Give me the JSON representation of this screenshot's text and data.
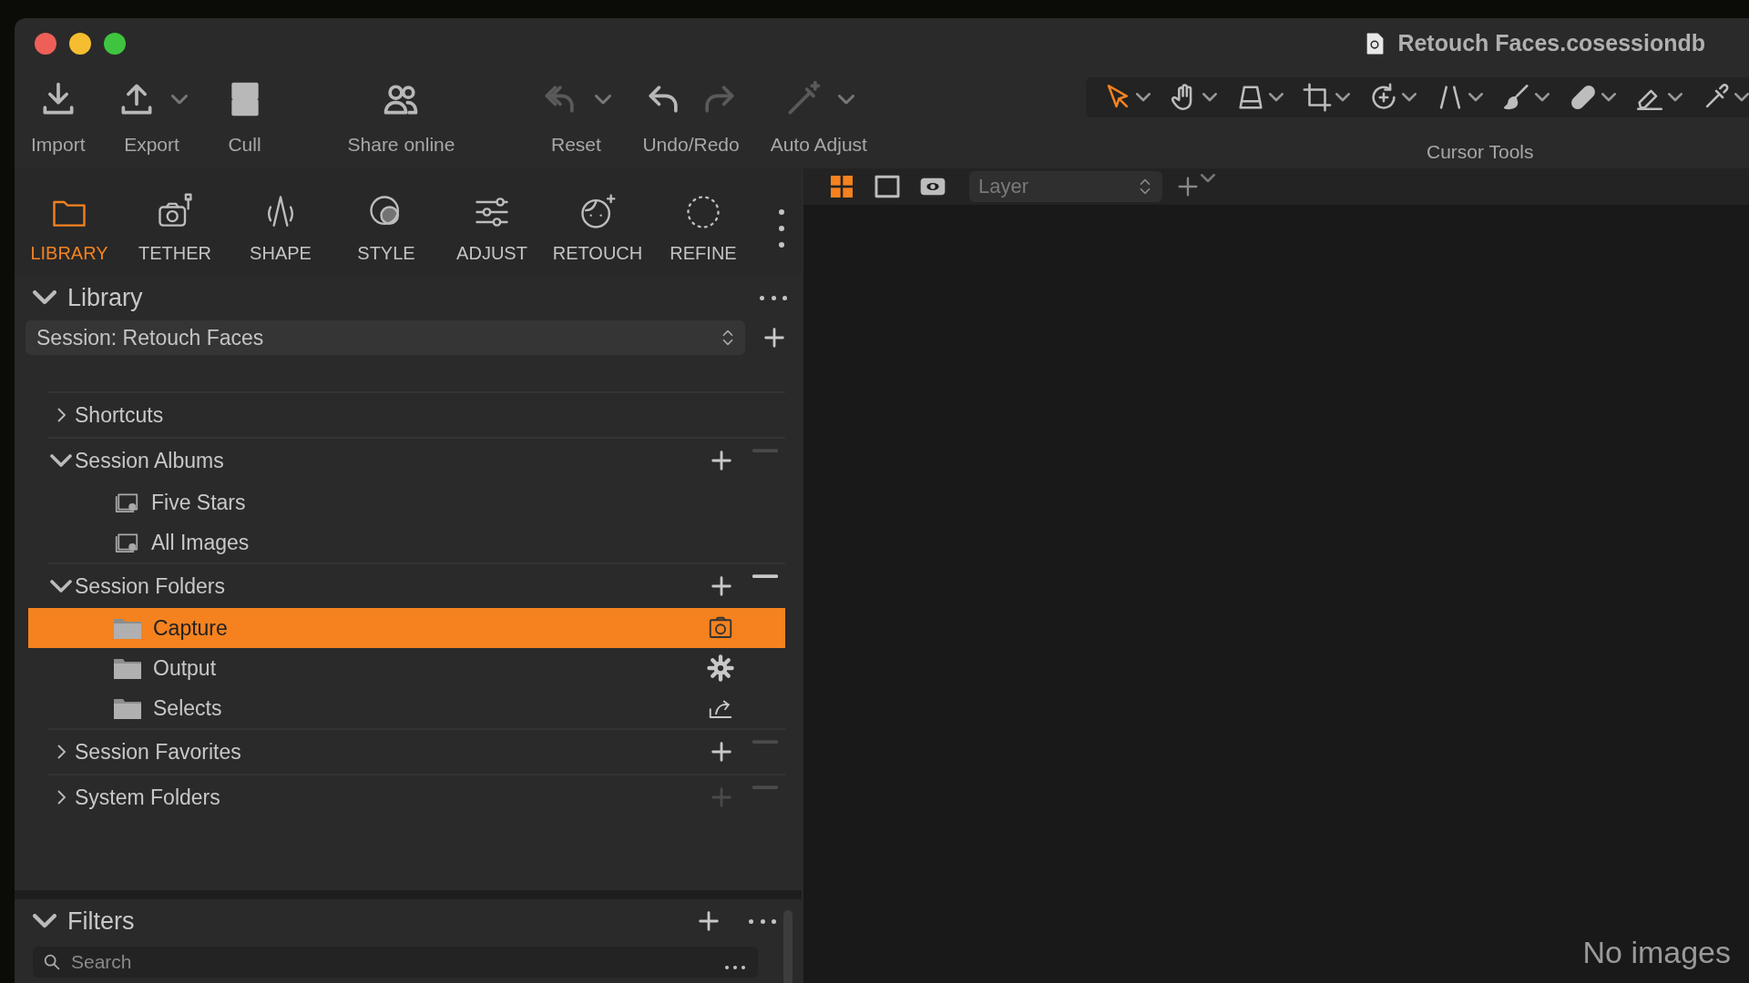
{
  "window": {
    "title": "Retouch Faces.cosessiondb"
  },
  "toolbar": {
    "items": [
      {
        "label": "Import",
        "icons": [
          {
            "kind": "import",
            "disabled": false
          }
        ],
        "menu": false
      },
      {
        "label": "Export",
        "icons": [
          {
            "kind": "export",
            "disabled": false
          }
        ],
        "menu": true
      },
      {
        "label": "Cull",
        "icons": [
          {
            "kind": "cull",
            "disabled": false
          }
        ],
        "menu": false
      },
      {
        "label": "Share online",
        "icons": [
          {
            "kind": "share",
            "disabled": false
          }
        ],
        "menu": false
      },
      {
        "label": "Reset",
        "icons": [
          {
            "kind": "reset",
            "disabled": true
          }
        ],
        "menu": true
      },
      {
        "label": "Undo/Redo",
        "icons": [
          {
            "kind": "undo",
            "disabled": false
          },
          {
            "kind": "redo",
            "disabled": true
          }
        ],
        "menu": false
      },
      {
        "label": "Auto Adjust",
        "icons": [
          {
            "kind": "wand",
            "disabled": true
          }
        ],
        "menu": true
      }
    ]
  },
  "cursor_tools": {
    "label": "Cursor Tools",
    "tools": [
      {
        "kind": "pointer",
        "selected": true
      },
      {
        "kind": "hand",
        "selected": false
      },
      {
        "kind": "keystone",
        "selected": false
      },
      {
        "kind": "crop",
        "selected": false
      },
      {
        "kind": "rotate",
        "selected": false
      },
      {
        "kind": "lines",
        "selected": false
      },
      {
        "kind": "brush",
        "selected": false
      },
      {
        "kind": "bandage",
        "selected": false
      },
      {
        "kind": "eraser",
        "selected": false
      },
      {
        "kind": "picker",
        "selected": false
      }
    ]
  },
  "tool_tabs": [
    {
      "label": "LIBRARY",
      "kind": "library",
      "selected": true
    },
    {
      "label": "TETHER",
      "kind": "tether",
      "selected": false
    },
    {
      "label": "SHAPE",
      "kind": "shape",
      "selected": false
    },
    {
      "label": "STYLE",
      "kind": "style",
      "selected": false
    },
    {
      "label": "ADJUST",
      "kind": "adjust",
      "selected": false
    },
    {
      "label": "RETOUCH",
      "kind": "retouch",
      "selected": false
    },
    {
      "label": "REFINE",
      "kind": "refine",
      "selected": false
    }
  ],
  "library": {
    "title": "Library",
    "session": "Session: Retouch Faces",
    "groups": [
      {
        "label": "Shortcuts",
        "expanded": false
      },
      {
        "label": "Session Albums",
        "expanded": true,
        "actions": [
          {
            "kind": "add",
            "disabled": false
          },
          {
            "kind": "remove",
            "disabled": true
          }
        ],
        "children": [
          {
            "label": "Five Stars",
            "kind": "album",
            "selected": false
          },
          {
            "label": "All Images",
            "kind": "album",
            "selected": false
          }
        ]
      },
      {
        "label": "Session Folders",
        "expanded": true,
        "actions": [
          {
            "kind": "add",
            "disabled": false
          },
          {
            "kind": "remove",
            "disabled": false
          }
        ],
        "children": [
          {
            "label": "Capture",
            "kind": "capture",
            "selected": true
          },
          {
            "label": "Output",
            "kind": "output",
            "selected": false
          },
          {
            "label": "Selects",
            "kind": "selects",
            "selected": false
          }
        ]
      },
      {
        "label": "Session Favorites",
        "expanded": false,
        "actions": [
          {
            "kind": "add",
            "disabled": false
          },
          {
            "kind": "remove",
            "disabled": true
          }
        ]
      },
      {
        "label": "System Folders",
        "expanded": false,
        "actions": [
          {
            "kind": "add",
            "disabled": true
          },
          {
            "kind": "remove",
            "disabled": true
          }
        ]
      }
    ]
  },
  "filters": {
    "title": "Filters",
    "search": {
      "placeholder": "Search"
    }
  },
  "viewer": {
    "view_modes": [
      {
        "kind": "grid",
        "selected": true
      },
      {
        "kind": "single",
        "selected": false
      },
      {
        "kind": "eye",
        "selected": false
      }
    ],
    "layer_select": {
      "value": "Layer",
      "disabled": true
    },
    "message": "No images"
  }
}
